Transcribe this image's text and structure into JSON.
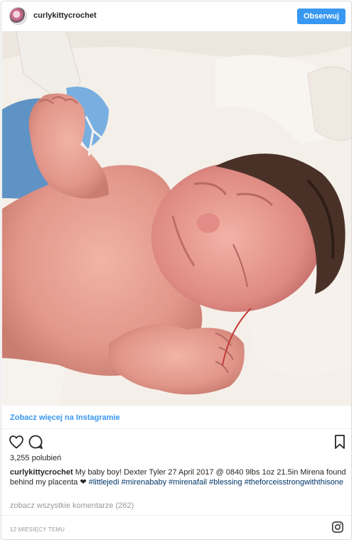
{
  "header": {
    "username": "curlykittycrochet",
    "follow_label": "Obserwuj"
  },
  "post": {
    "view_more_label": "Zobacz więcej na Instagramie",
    "likes_text": "3,255 polubień",
    "caption": {
      "username": "curlykittycrochet",
      "text": "My baby boy! Dexter Tyler 27 April 2017 @ 0840 9lbs 1oz 21.5in Mirena found behind my placenta",
      "emoji": "❤",
      "hashtags": [
        "#littlejedi",
        "#mirenababy",
        "#mirenafail",
        "#blessing",
        "#theforceisstrongwiththisone"
      ]
    },
    "comments_link": "zobacz wszystkie komentarze (262)",
    "timestamp": "12 MIESIĘCY TEMU"
  },
  "icons": {
    "like": "heart-outline-icon",
    "comment": "comment-bubble-icon",
    "save": "bookmark-icon",
    "instagram": "instagram-logo-icon"
  },
  "colors": {
    "accent": "#3897f0",
    "hashtag": "#003569",
    "muted": "#999999"
  }
}
